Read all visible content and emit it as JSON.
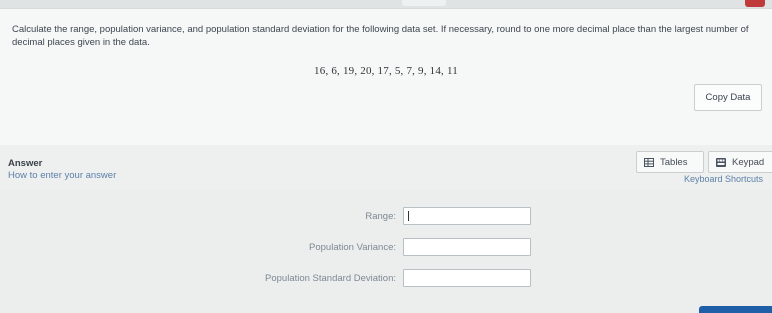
{
  "question": {
    "prompt": "Calculate the range, population variance, and population standard deviation for the following data set. If necessary, round to one more decimal place than the largest number of decimal places given in the data.",
    "data_set": "16, 6, 19, 20, 17, 5, 7, 9, 14, 11",
    "copy_label": "Copy Data"
  },
  "answer": {
    "title": "Answer",
    "help_link": "How to enter your answer",
    "tables_label": "Tables",
    "keypad_label": "Keypad",
    "shortcuts_link": "Keyboard Shortcuts",
    "fields": [
      {
        "label": "Range:",
        "value": ""
      },
      {
        "label": "Population Variance:",
        "value": ""
      },
      {
        "label": "Population Standard Deviation:",
        "value": ""
      }
    ]
  }
}
